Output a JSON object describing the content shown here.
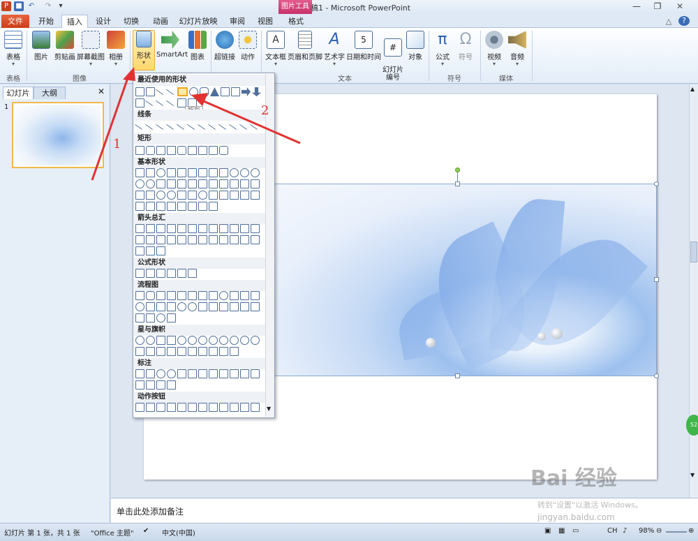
{
  "window": {
    "title": "演示文稿1 - Microsoft PowerPoint",
    "context_tab": "图片工具",
    "context_subtab": "格式"
  },
  "tabs": [
    "文件",
    "开始",
    "插入",
    "设计",
    "切换",
    "动画",
    "幻灯片放映",
    "审阅",
    "视图"
  ],
  "ribbon": {
    "buttons": {
      "table": "表格",
      "picture": "图片",
      "clipart": "剪贴画",
      "screenshot": "屏幕截图",
      "album": "相册",
      "shapes": "形状",
      "smartart": "SmartArt",
      "chart": "图表",
      "hyperlink": "超链接",
      "action": "动作",
      "textbox": "文本框",
      "header_footer": "页眉和页脚",
      "wordart": "艺术字",
      "datetime": "日期和时间",
      "slide_number": "幻灯片\n编号",
      "object": "对象",
      "equation": "公式",
      "symbol": "符号",
      "video": "视频",
      "audio": "音频"
    },
    "groups": {
      "tables": "表格",
      "images": "图像",
      "text": "文本",
      "symbols": "符号",
      "media": "媒体"
    }
  },
  "left_panel": {
    "tab_slides": "幻灯片",
    "tab_outline": "大纲",
    "slide_number": "1"
  },
  "shapes_menu": {
    "sections": [
      "最近使用的形状",
      "线条",
      "矩形",
      "基本形状",
      "箭头总汇",
      "公式形状",
      "流程图",
      "星与旗帜",
      "标注",
      "动作按钮"
    ],
    "tooltip": "矩形"
  },
  "notes_placeholder": "单击此处添加备注",
  "status": {
    "slide_info": "幻灯片 第 1 张，共 1 张",
    "theme": "\"Office 主题\"",
    "language": "中文(中国)",
    "ime": "CH",
    "zoom": "98%"
  },
  "annotations": {
    "label1": "1",
    "label2": "2",
    "color": "#e23131"
  },
  "watermark": {
    "main": "Bai 经验",
    "sub": "jingyan.baidu.com",
    "activation": "转到\"设置\"以激活 Windows。"
  },
  "side_badge": "52"
}
